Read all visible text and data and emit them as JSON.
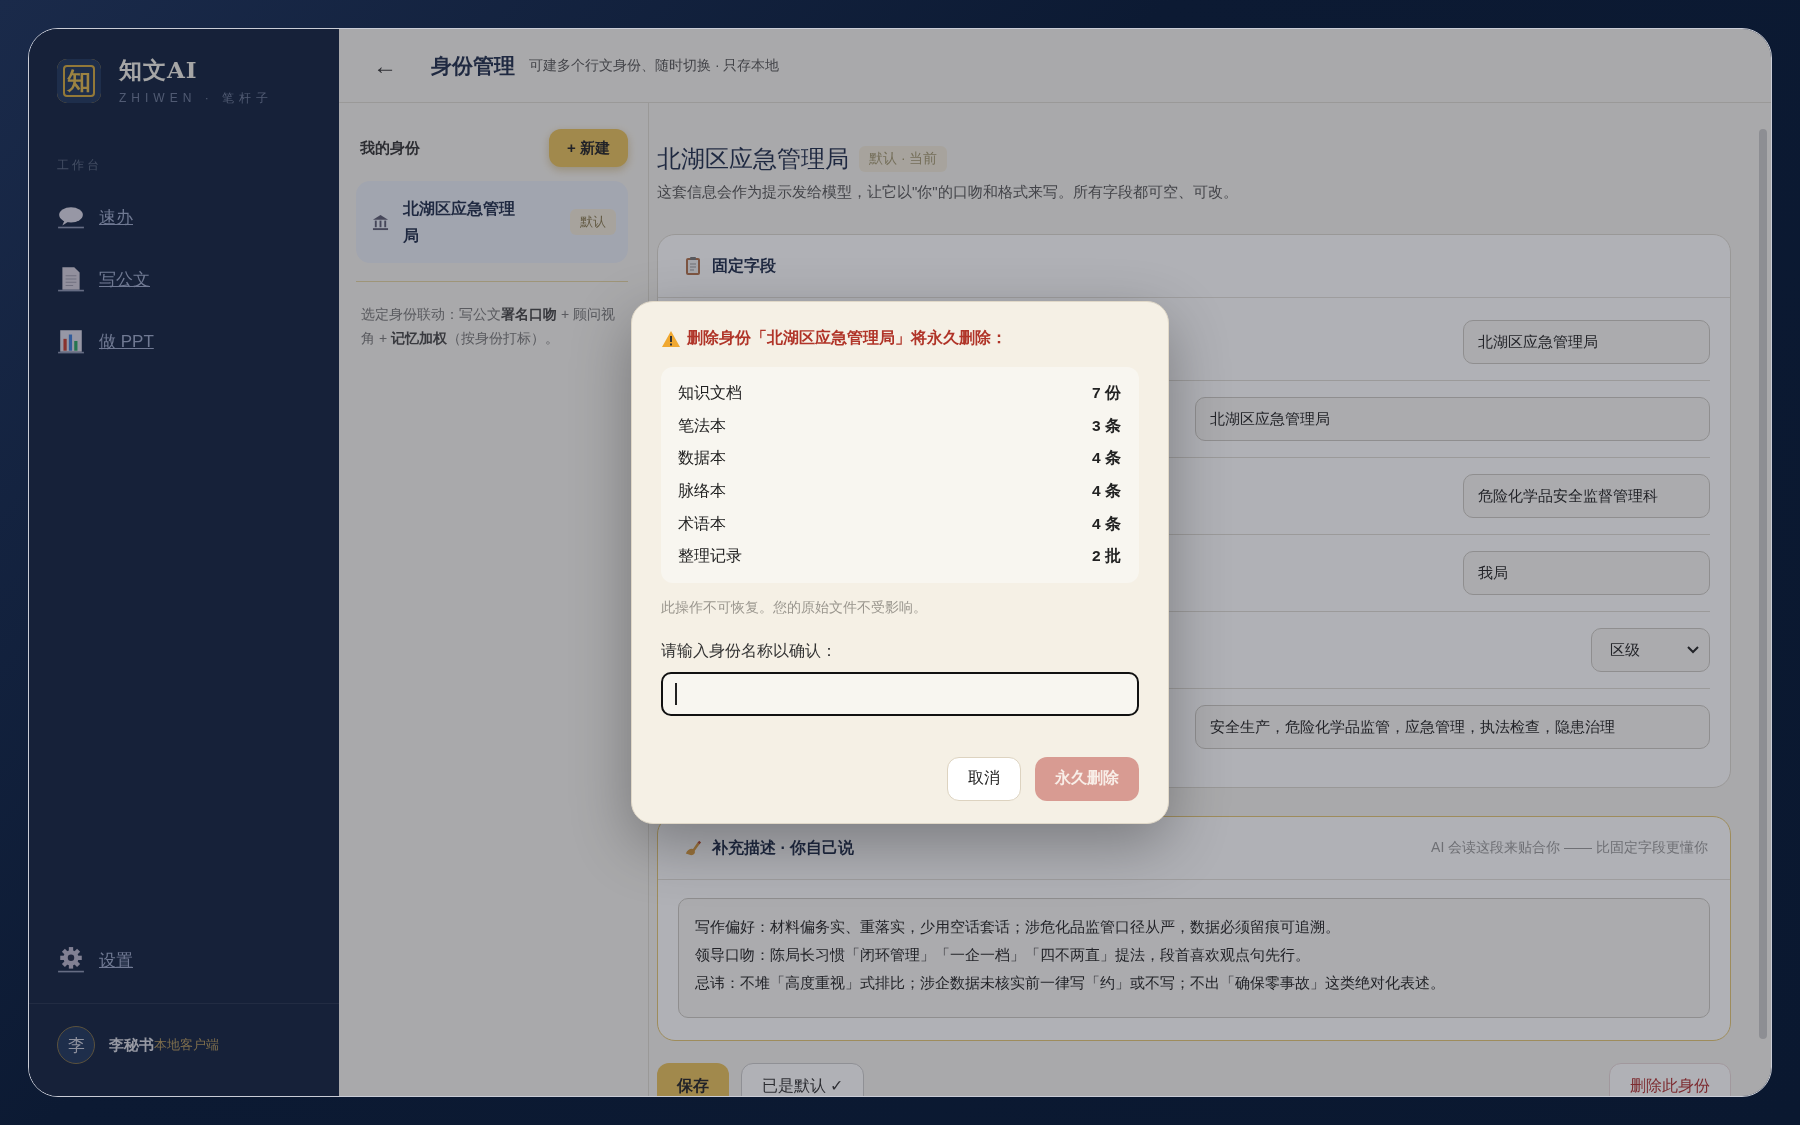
{
  "sidebar": {
    "logo_mark": "知",
    "app_name": "知文AI",
    "app_subtitle": "ZHIWEN · 笔杆子",
    "section_label": "工作台",
    "items": [
      {
        "label": "速办",
        "kind": "chat"
      },
      {
        "label": "写公文",
        "kind": "document"
      },
      {
        "label": "做 PPT",
        "kind": "chart"
      }
    ],
    "settings": {
      "label": "设置"
    },
    "user": {
      "avatar": "李",
      "name": "李秘书",
      "tag": "本地客户端"
    }
  },
  "header": {
    "back": "←",
    "title": "身份管理",
    "subtitle": "可建多个行文身份、随时切换 · 只存本地"
  },
  "identity_panel": {
    "title": "我的身份",
    "new_button": "+ 新建",
    "identities": [
      {
        "name": "北湖区应急管理局",
        "badge": "默认",
        "selected": true
      }
    ],
    "note": "选定身份联动：写公文**署名口吻** + 顾问视角 + **记忆加权**（按身份打标）。"
  },
  "detail": {
    "title": "北湖区应急管理局",
    "badge": "默认 · 当前",
    "description": "这套信息会作为提示发给模型，让它以\"你\"的口吻和格式来写。所有字段都可空、可改。",
    "fixed_section": {
      "title": "固定字段",
      "fields": [
        {
          "kind": "short",
          "value": "北湖区应急管理局"
        },
        {
          "kind": "long",
          "value": "北湖区应急管理局"
        },
        {
          "kind": "short",
          "value": "危险化学品安全监督管理科"
        },
        {
          "kind": "short",
          "value": "我局"
        },
        {
          "kind": "select",
          "value": "区级"
        },
        {
          "kind": "long",
          "value": "安全生产，危险化学品监管，应急管理，执法检查，隐患治理"
        }
      ]
    },
    "free_section": {
      "title": "补充描述 · 你自己说",
      "hint": "AI 会读这段来贴合你 —— 比固定字段更懂你",
      "lines": [
        "写作偏好：材料偏务实、重落实，少用空话套话；涉危化品监管口径从严，数据必须留痕可追溯。",
        "领导口吻：陈局长习惯「闭环管理」「一企一档」「四不两直」提法，段首喜欢观点句先行。",
        "忌讳：不堆「高度重视」式排比；涉企数据未核实前一律写「约」或不写；不出「确保零事故」这类绝对化表述。"
      ]
    },
    "actions": [
      {
        "label": "保存",
        "kind": "primary"
      },
      {
        "label": "已是默认 ✓",
        "kind": "secondary"
      },
      {
        "label": "删除此身份",
        "kind": "danger"
      }
    ]
  },
  "dialog": {
    "title": "删除身份「北湖区应急管理局」将永久删除：",
    "items": [
      {
        "label": "知识文档",
        "count": "7 份"
      },
      {
        "label": "笔法本",
        "count": "3 条"
      },
      {
        "label": "数据本",
        "count": "4 条"
      },
      {
        "label": "脉络本",
        "count": "4 条"
      },
      {
        "label": "术语本",
        "count": "4 条"
      },
      {
        "label": "整理记录",
        "count": "2 批"
      }
    ],
    "note": "此操作不可恢复。您的原始文件不受影响。",
    "confirm_label": "请输入身份名称以确认：",
    "buttons": [
      {
        "label": "取消",
        "kind": "cancel",
        "disabled": false
      },
      {
        "label": "永久删除",
        "kind": "danger",
        "disabled": true
      }
    ]
  }
}
